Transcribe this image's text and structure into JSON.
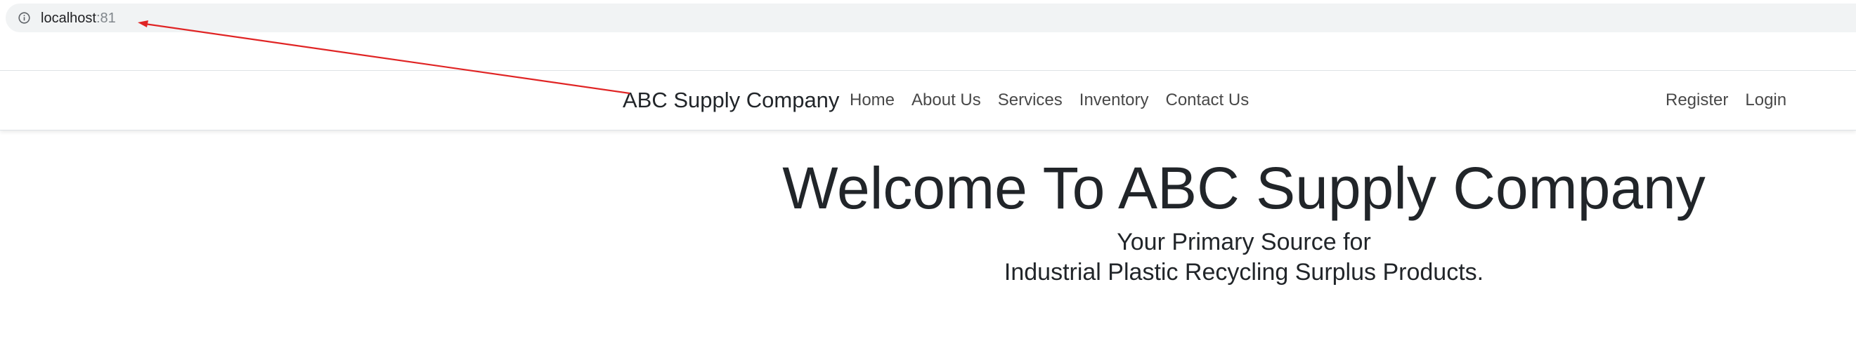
{
  "browser": {
    "url_host": "localhost",
    "url_port": ":81",
    "info_icon": "info-icon"
  },
  "navbar": {
    "brand": "ABC Supply Company",
    "links": [
      "Home",
      "About Us",
      "Services",
      "Inventory",
      "Contact Us"
    ],
    "right_links": [
      "Register",
      "Login"
    ]
  },
  "hero": {
    "title": "Welcome To ABC Supply Company",
    "subtitle_line1": "Your Primary Source for",
    "subtitle_line2": "Industrial Plastic Recycling Surplus Products."
  },
  "annotation": {
    "arrow_color": "#e02424"
  }
}
